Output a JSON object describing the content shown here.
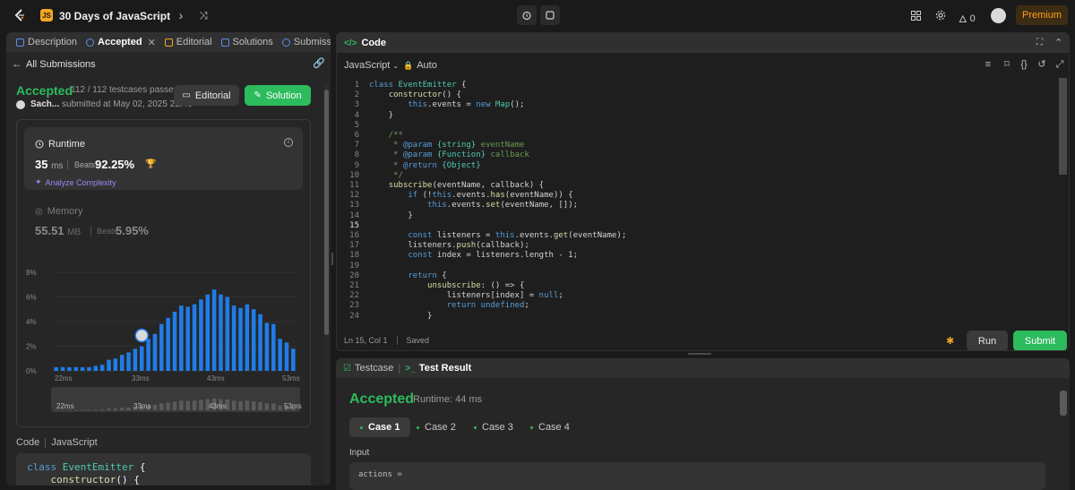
{
  "topbar": {
    "plan_badge": "JS",
    "plan_title": "30 Days of JavaScript",
    "streak_count": "0",
    "premium_label": "Premium"
  },
  "left_tabs": [
    {
      "label": "Description",
      "color": "#5b8def"
    },
    {
      "label": "Accepted",
      "color": "#5b8def"
    },
    {
      "label": "Editorial",
      "color": "#f5a623"
    },
    {
      "label": "Solutions",
      "color": "#5b8def"
    },
    {
      "label": "Submissio",
      "color": "#5b8def"
    }
  ],
  "submission": {
    "back_label": "All Submissions",
    "status": "Accepted",
    "testcases": "112 / 112 testcases passed",
    "user": "Sach...",
    "submitted_at": "submitted at May 02, 2025 22:46",
    "editorial_label": "Editorial",
    "solution_label": "Solution"
  },
  "runtime": {
    "label": "Runtime",
    "value": "35",
    "unit": "ms",
    "beats_label": "Beats",
    "beats_value": "92.25%",
    "analyze_label": "Analyze Complexity"
  },
  "memory": {
    "label": "Memory",
    "value": "55.51",
    "unit": "MB",
    "beats_label": "Beats",
    "beats_value": "5.95%"
  },
  "chart_data": {
    "type": "bar",
    "yticks": [
      "8%",
      "6%",
      "4%",
      "2%",
      "0%"
    ],
    "ylim": [
      0,
      8
    ],
    "xticks": [
      "22ms",
      "33ms",
      "43ms",
      "53ms"
    ],
    "xlim": [
      22,
      53
    ],
    "x": [
      22,
      23,
      24,
      25,
      26,
      27,
      28,
      29,
      30,
      31,
      32,
      33,
      34,
      35,
      36,
      37,
      38,
      39,
      40,
      41,
      42,
      43,
      44,
      45,
      46,
      47,
      48,
      49,
      50,
      51,
      52,
      53
    ],
    "values": [
      0.3,
      0.3,
      0.3,
      0.3,
      0.3,
      0.3,
      0.4,
      0.5,
      0.9,
      1.0,
      1.3,
      1.5,
      1.8,
      2.0,
      2.6,
      3.0,
      3.8,
      4.3,
      4.8,
      5.3,
      5.2,
      5.4,
      5.8,
      6.2,
      6.6,
      6.2,
      6.0,
      5.3,
      5.1,
      5.4,
      5.0,
      4.6,
      3.9,
      3.8,
      2.6,
      2.3,
      1.8
    ],
    "highlight_x": 35,
    "accent_color": "#1f7ce8",
    "mini_xticks": [
      "22ms",
      "33ms",
      "43ms",
      "53ms"
    ]
  },
  "code_label": "Code",
  "code_lang": "JavaScript",
  "code_preview": [
    "class EventEmitter {",
    "    constructor() {"
  ],
  "editor": {
    "title": "Code",
    "language": "JavaScript",
    "mode": "Auto",
    "status_position": "Ln 15, Col 1",
    "status_saved": "Saved",
    "run_label": "Run",
    "submit_label": "Submit",
    "current_line": 15,
    "lines": [
      "class EventEmitter {",
      "    constructor() {",
      "        this.events = new Map();",
      "    }",
      "",
      "    /**",
      "     * @param {string} eventName",
      "     * @param {Function} callback",
      "     * @return {Object}",
      "     */",
      "    subscribe(eventName, callback) {",
      "        if (!this.events.has(eventName)) {",
      "            this.events.set(eventName, []);",
      "        }",
      "",
      "        const listeners = this.events.get(eventName);",
      "        listeners.push(callback);",
      "        const index = listeners.length - 1;",
      "",
      "        return {",
      "            unsubscribe: () => {",
      "                listeners[index] = null;",
      "                return undefined;",
      "            }"
    ]
  },
  "test_panel": {
    "testcase_label": "Testcase",
    "result_label": "Test Result",
    "status": "Accepted",
    "runtime": "Runtime: 44 ms",
    "cases": [
      "Case 1",
      "Case 2",
      "Case 3",
      "Case 4"
    ],
    "input_label": "Input",
    "input_value": "actions ="
  }
}
